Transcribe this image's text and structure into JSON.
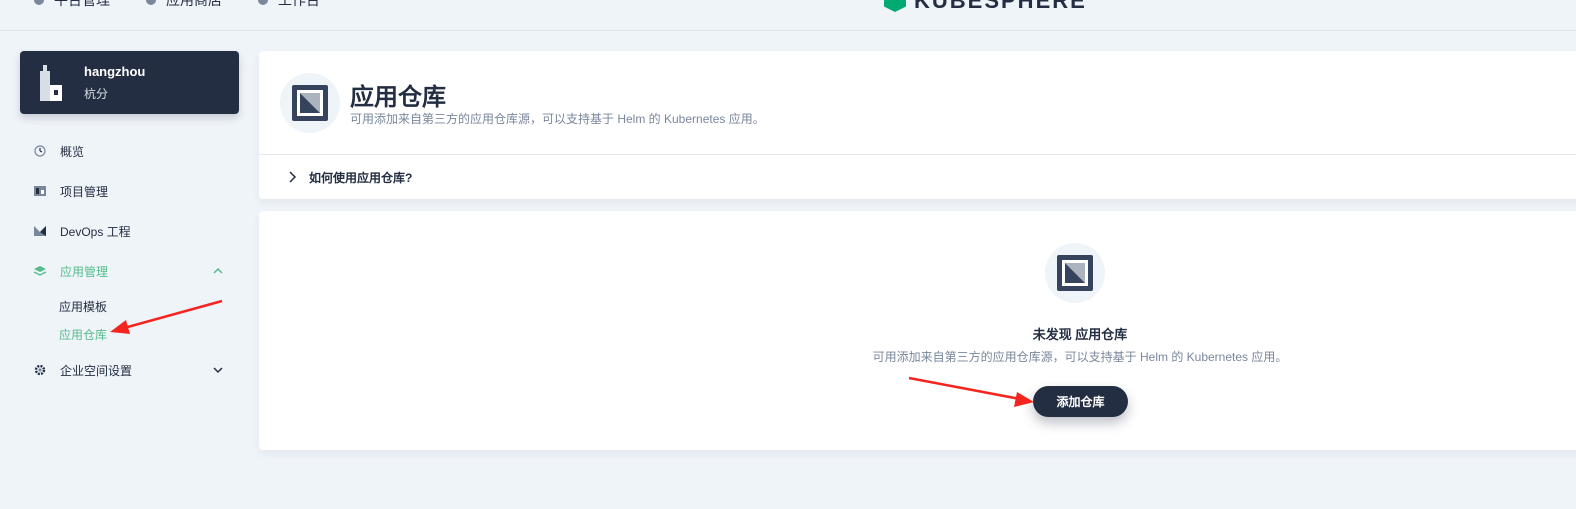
{
  "topnav": {
    "items": [
      "平台管理",
      "应用商店",
      "工作台"
    ],
    "logo_text": "KUBESPHERE"
  },
  "workspace": {
    "name": "hangzhou",
    "subtitle": "杭分"
  },
  "sidebar": {
    "items": [
      {
        "label": "概览",
        "icon": "dashboard-icon"
      },
      {
        "label": "项目管理",
        "icon": "project-icon"
      },
      {
        "label": "DevOps 工程",
        "icon": "devops-icon"
      },
      {
        "label": "应用管理",
        "icon": "layers-icon",
        "expanded": true
      },
      {
        "label": "企业空间设置",
        "icon": "gear-icon",
        "expanded": false
      }
    ],
    "sub_items": [
      {
        "label": "应用模板",
        "active": false
      },
      {
        "label": "应用仓库",
        "active": true
      }
    ]
  },
  "header": {
    "title": "应用仓库",
    "description": "可用添加来自第三方的应用仓库源，可以支持基于 Helm 的 Kubernetes 应用。",
    "faq_label": "如何使用应用仓库?"
  },
  "empty_state": {
    "title": "未发现 应用仓库",
    "description": "可用添加来自第三方的应用仓库源，可以支持基于 Helm 的 Kubernetes 应用。",
    "button_label": "添加仓库"
  },
  "colors": {
    "accent_green": "#55bc8a",
    "dark": "#242e42",
    "annotation_red": "#f5241e"
  }
}
